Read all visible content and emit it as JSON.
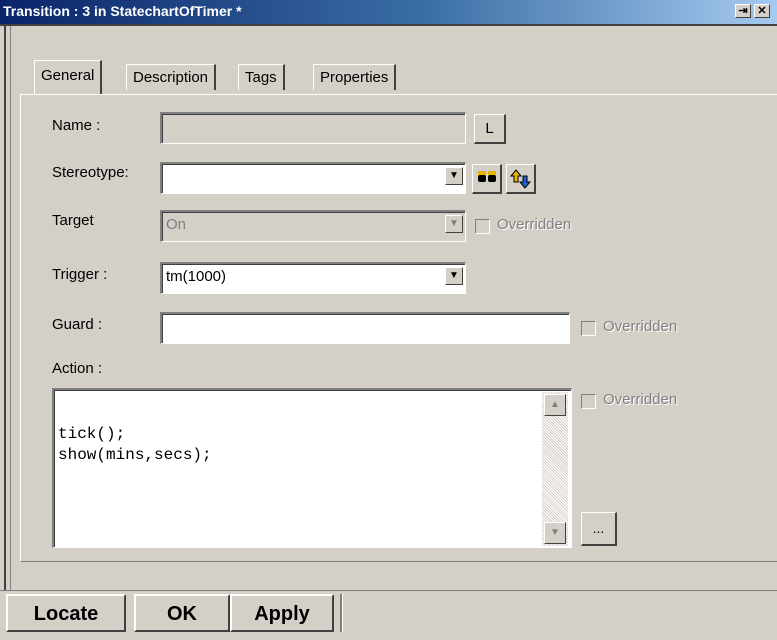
{
  "window": {
    "title": "Transition : 3 in StatechartOfTimer *",
    "pin_glyph": "⇥",
    "close_glyph": "✕"
  },
  "tabs": [
    {
      "label": "General",
      "active": true
    },
    {
      "label": "Description",
      "active": false
    },
    {
      "label": "Tags",
      "active": false
    },
    {
      "label": "Properties",
      "active": false
    }
  ],
  "general": {
    "name": {
      "label": "Name :",
      "value": "",
      "locate_button": "L"
    },
    "stereotype": {
      "label": "Stereotype:",
      "value": ""
    },
    "target": {
      "label": "Target",
      "value": "On",
      "overridden_label": "Overridden",
      "overridden_checked": false
    },
    "trigger": {
      "label": "Trigger :",
      "value": "tm(1000)"
    },
    "guard": {
      "label": "Guard :",
      "value": "",
      "overridden_label": "Overridden",
      "overridden_checked": false
    },
    "action": {
      "label": "Action :",
      "line1": "tick();",
      "line2": "show(mins,secs);",
      "overridden_label": "Overridden",
      "overridden_checked": false,
      "more_button": "..."
    }
  },
  "buttons": {
    "locate": "Locate",
    "ok": "OK",
    "apply": "Apply"
  },
  "icons": {
    "dropdown": "▼",
    "scroll_up": "▲",
    "scroll_down": "▼",
    "find": "binoculars-icon",
    "move": "up-down-arrows-icon"
  },
  "colors": {
    "title_bar": "#0a246a",
    "face": "#d4d0c8",
    "disabled_text": "#808080"
  }
}
